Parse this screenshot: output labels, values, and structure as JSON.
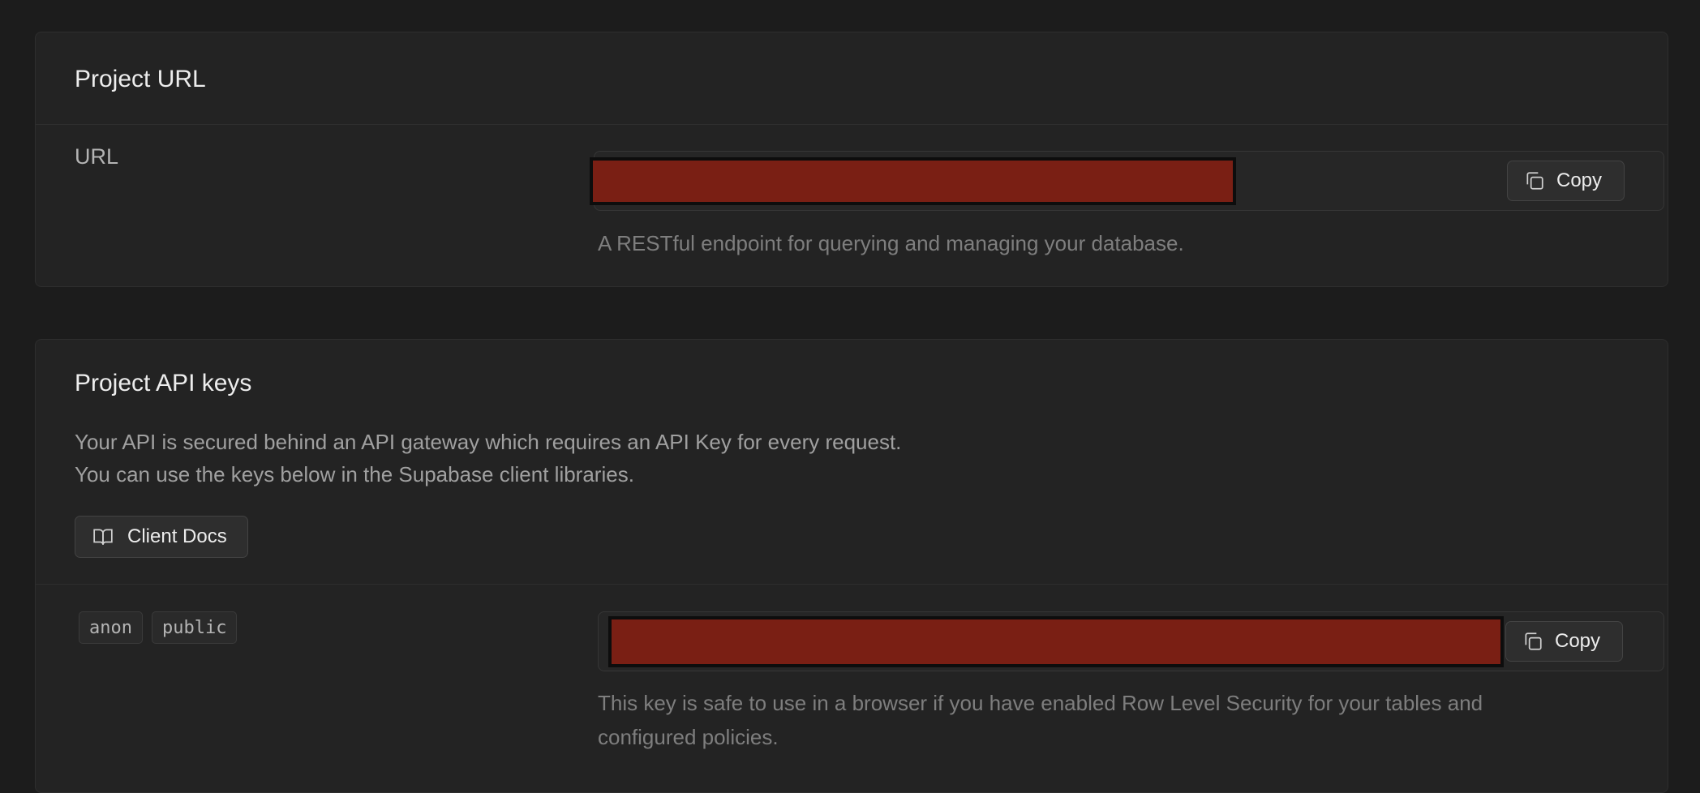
{
  "project_url": {
    "title": "Project URL",
    "row_label": "URL",
    "copy_label": "Copy",
    "help_text": "A RESTful endpoint for querying and managing your database."
  },
  "api_keys": {
    "title": "Project API keys",
    "description_line1": "Your API is secured behind an API gateway which requires an API Key for every request.",
    "description_line2": "You can use the keys below in the Supabase client libraries.",
    "docs_button_label": "Client Docs",
    "anon_key": {
      "tags": [
        "anon",
        "public"
      ],
      "copy_label": "Copy",
      "help_text_line1": "This key is safe to use in a browser if you have enabled Row Level Security for your tables and",
      "help_text_line2": "configured policies."
    }
  },
  "colors": {
    "background": "#1c1c1c",
    "panel": "#232323",
    "redaction": "#7a1f14"
  },
  "icons": {
    "copy": "copy-icon",
    "docs": "book-open-icon"
  }
}
